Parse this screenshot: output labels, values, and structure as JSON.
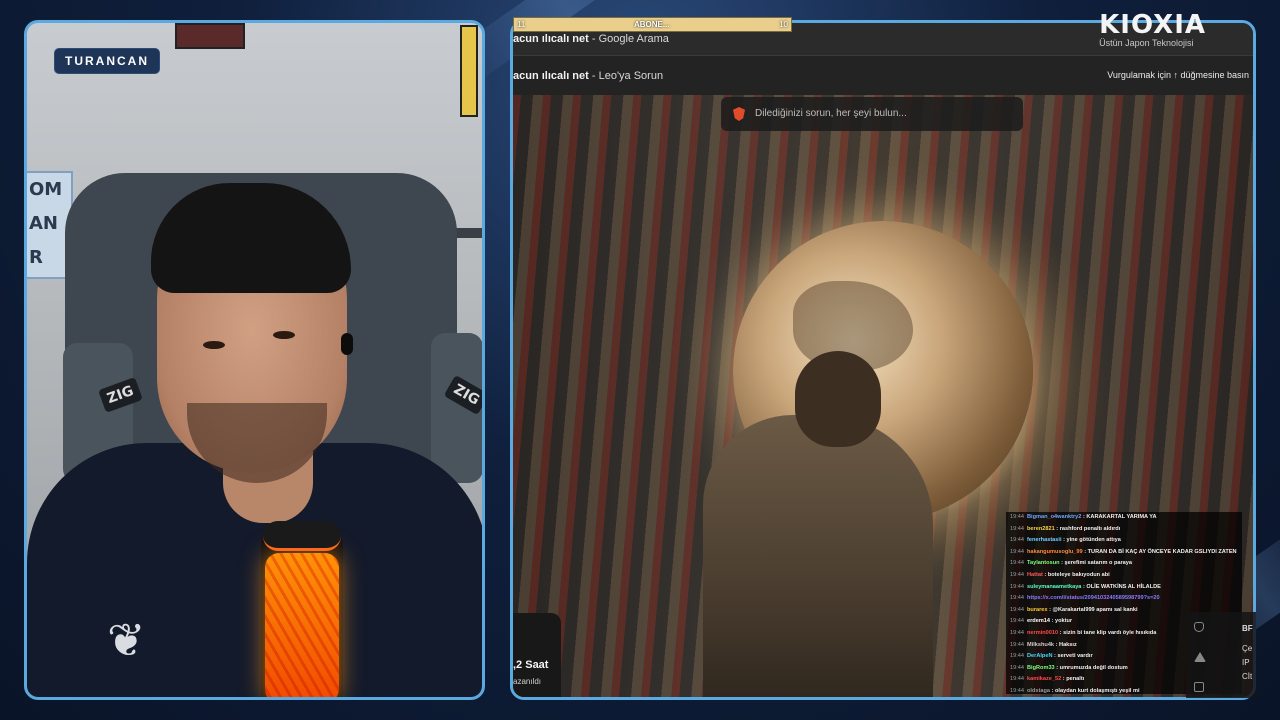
{
  "camera": {
    "streamer_name": "TURANCAN",
    "poster_letters": [
      "OM",
      "AN",
      "R"
    ],
    "chair_logo": "ZIG"
  },
  "sub_goal": {
    "current": "11",
    "label": "ABONE...",
    "target": "10"
  },
  "browser": {
    "tab1_bold": "acun ılıcalı net",
    "tab1_rest": " - Google Arama",
    "tab2_bold": "acun ılıcalı net",
    "tab2_rest": " - Leo'ya Sorun",
    "hint": "Vurgulamak için ↑ düğmesine basın",
    "search_placeholder": "Dilediğinizi sorun, her şeyi bulun..."
  },
  "sponsor": {
    "name": "KIOXIA",
    "tagline": "Üstün Japon Teknolojisi"
  },
  "stats": {
    "big": ",2 Saat",
    "small": "azanıldı"
  },
  "side_panel": {
    "items": [
      "BF",
      "Çe",
      "IP",
      "Cİt"
    ]
  },
  "chat": {
    "messages": [
      {
        "time": "19:44",
        "user": "Bigman_o4wanktry2",
        "color": "#6fa8ff",
        "msg": "KARAKARTAL YARIMA YA"
      },
      {
        "time": "19:44",
        "user": "beren2821",
        "color": "#f2d34a",
        "msg": "rashford penaltı aldırdı"
      },
      {
        "time": "19:44",
        "user": "fenerhastasii",
        "color": "#6fd0ff",
        "msg": "yine götünden attıya"
      },
      {
        "time": "19:44",
        "user": "hakangumusoglu_99",
        "color": "#ff8a3d",
        "msg": "TURAN DA Bİ KAÇ AY ÖNCEYE KADAR GSLIYDI ZATEN"
      },
      {
        "time": "19:44",
        "user": "Taylantosun",
        "color": "#7dff7d",
        "msg": "şerefimi satarım o paraya"
      },
      {
        "time": "19:44",
        "user": "Hattat",
        "color": "#ff5a5a",
        "msg": "boteleye bakıyodun abi"
      },
      {
        "time": "19:44",
        "user": "suleymanaametkaya",
        "color": "#5affc8",
        "msg": "OLİE WATKİNS AL HİLALDE"
      },
      {
        "time": "19:44",
        "user": "",
        "color": "#8a7cff",
        "msg": "https://x.com/i/status/2094103240589598799?s=20"
      },
      {
        "time": "19:44",
        "user": "burarex",
        "color": "#ffcc33",
        "msg": "@Karakartal999 apamı sal kanki"
      },
      {
        "time": "19:44",
        "user": "erdem14",
        "color": "#ffffff",
        "msg": "yoktur"
      },
      {
        "time": "19:44",
        "user": "nermin0010",
        "color": "#ff4a4a",
        "msg": "sizin bi tane klip vardı öyle hısıkıda"
      },
      {
        "time": "19:44",
        "user": "Milkshu4k",
        "color": "#cfcfcf",
        "msg": "Haksız"
      },
      {
        "time": "19:44",
        "user": "DerAlpeN",
        "color": "#4ad9ff",
        "msg": "serveti vardır"
      },
      {
        "time": "19:44",
        "user": "BigRom33",
        "color": "#7dff7d",
        "msg": "umrumuzda değil dostum"
      },
      {
        "time": "19:44",
        "user": "kamikaze_52",
        "color": "#ff4a4a",
        "msg": "penaltı"
      },
      {
        "time": "19:44",
        "user": "oldstaga",
        "color": "#9a9a9a",
        "msg": "olaydan kurt dolaşmıştı yeşil mi"
      }
    ]
  }
}
